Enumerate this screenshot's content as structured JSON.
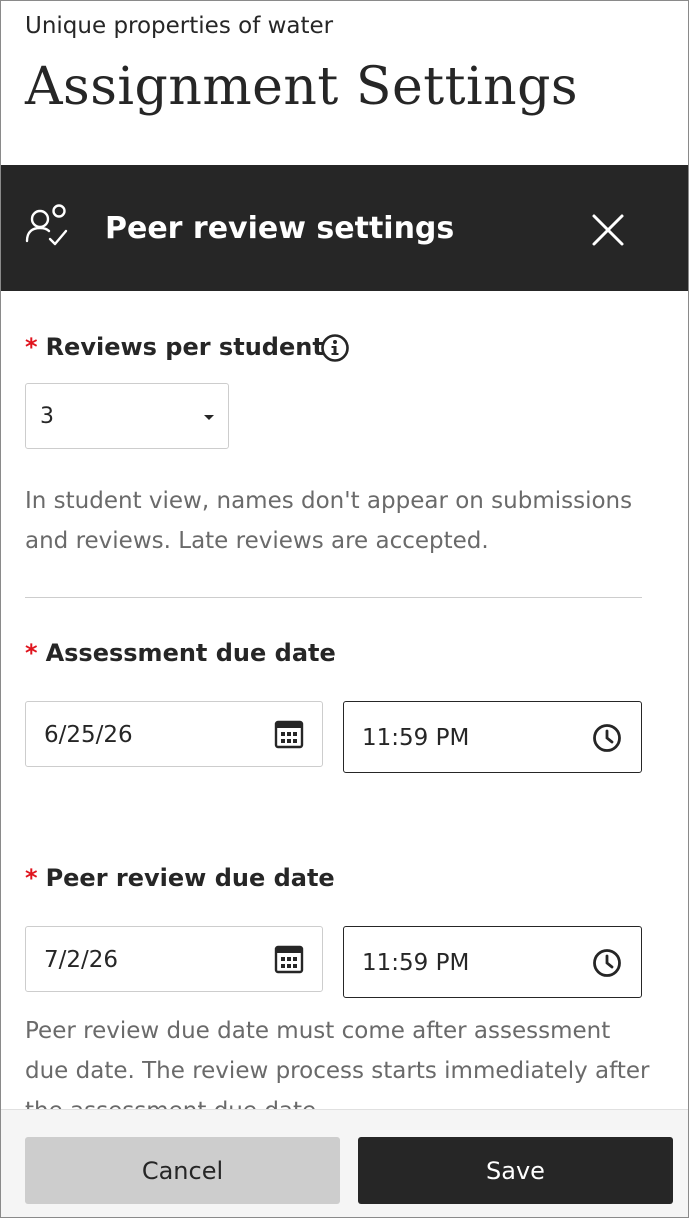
{
  "header": {
    "subtitle": "Unique properties of water",
    "title": "Assignment Settings"
  },
  "panel": {
    "title": "Peer review settings",
    "icon": "peer-review-icon",
    "close_icon": "close-icon"
  },
  "reviews_per_student": {
    "required_marker": "*",
    "label": "Reviews per student",
    "value": "3",
    "help": "In student view, names don't appear on submissions and reviews. Late reviews are accepted."
  },
  "assessment_due": {
    "required_marker": "*",
    "label": "Assessment due date",
    "date": "6/25/26",
    "time": "11:59 PM"
  },
  "peer_review_due": {
    "required_marker": "*",
    "label": "Peer review due date",
    "date": "7/2/26",
    "time": "11:59 PM",
    "help": "Peer review due date must come after assessment due date. The review process starts immediately after the assessment due date."
  },
  "footer": {
    "cancel_label": "Cancel",
    "save_label": "Save"
  },
  "colors": {
    "header_bg": "#262626",
    "required": "#e0141e",
    "help_text": "#6a6a6a"
  }
}
